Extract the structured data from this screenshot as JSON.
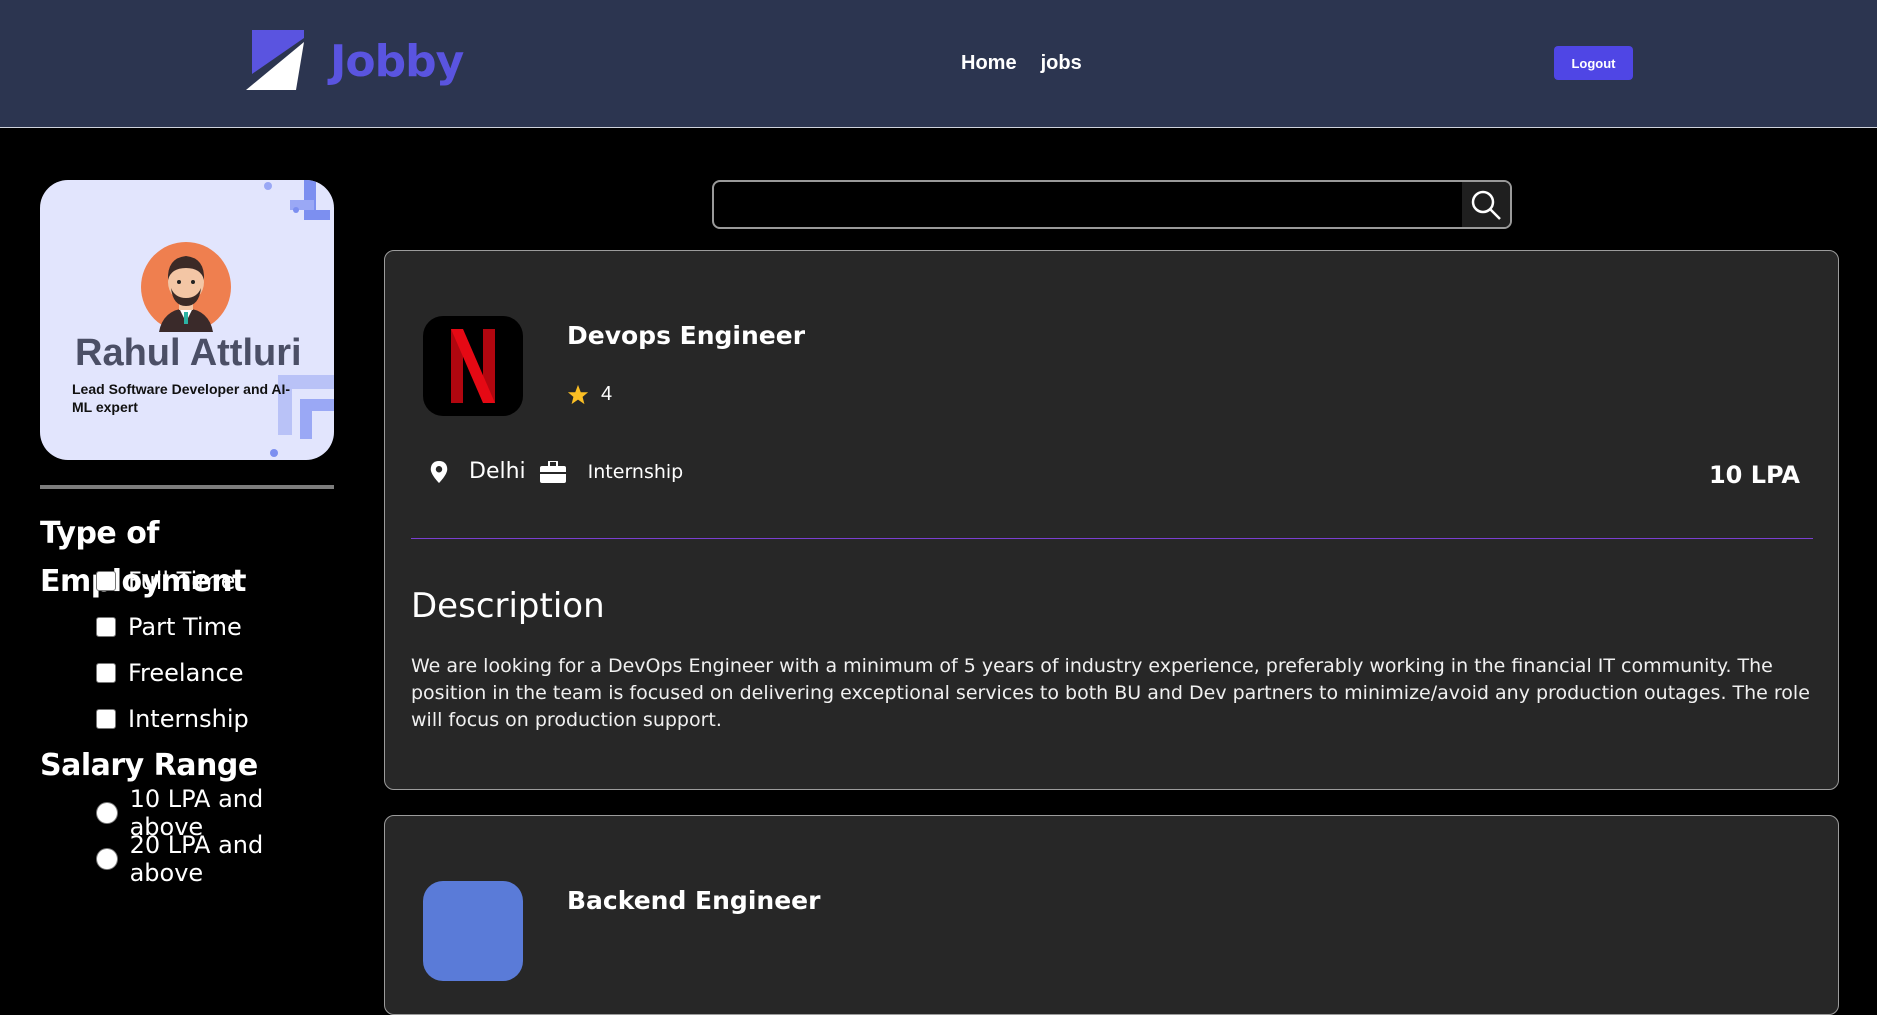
{
  "header": {
    "brand": "Jobby",
    "nav": [
      "Home",
      "jobs"
    ],
    "logout_label": "Logout",
    "bg_color": "#2c3550",
    "accent_color": "#4f46e5"
  },
  "profile": {
    "name": "Rahul Attluri",
    "bio": "Lead Software Developer and AI-ML expert"
  },
  "filters": {
    "employment_heading": "Type of Employment",
    "employment_options": [
      "Full Time",
      "Part Time",
      "Freelance",
      "Internship"
    ],
    "salary_heading": "Salary Range",
    "salary_options": [
      "10 LPA and above",
      "20 LPA and above"
    ]
  },
  "search": {
    "value": "",
    "icon": "search-icon"
  },
  "jobs": [
    {
      "title": "Devops Engineer",
      "company_logo": "netflix-logo",
      "rating": "4",
      "location": "Delhi",
      "employment_type": "Internship",
      "package": "10 LPA",
      "description_heading": "Description",
      "description": "We are looking for a DevOps Engineer with a minimum of 5 years of industry experience, preferably working in the financial IT community. The position in the team is focused on delivering exceptional services to both BU and Dev partners to minimize/avoid any production outages. The role will focus on production support."
    },
    {
      "title": "Backend Engineer"
    }
  ]
}
